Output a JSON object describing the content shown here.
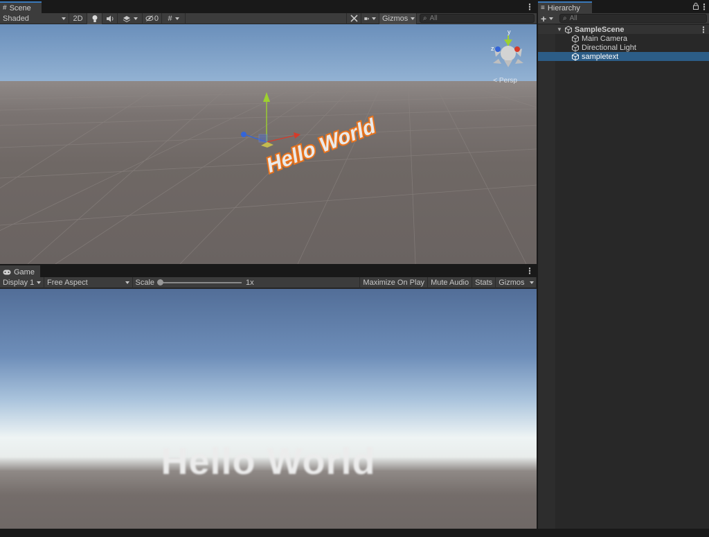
{
  "scene": {
    "tab_label": "Scene",
    "shading_mode": "Shaded",
    "mode_2d": "2D",
    "hidden_count": "0",
    "gizmos_label": "Gizmos",
    "search_placeholder": "All",
    "hello_text": "Hello World",
    "gizmo_axis_y": "y",
    "gizmo_axis_z": "z",
    "persp_label": "< Persp"
  },
  "game": {
    "tab_label": "Game",
    "display": "Display 1",
    "aspect": "Free Aspect",
    "scale_label": "Scale",
    "scale_value": "1x",
    "maximize_label": "Maximize On Play",
    "mute_label": "Mute Audio",
    "stats_label": "Stats",
    "gizmos_label": "Gizmos",
    "hello_text": "Hello World"
  },
  "hierarchy": {
    "tab_label": "Hierarchy",
    "add_label": "+",
    "search_placeholder": "All",
    "scene_name": "SampleScene",
    "items": [
      {
        "label": "Main Camera"
      },
      {
        "label": "Directional Light"
      },
      {
        "label": "sampletext"
      }
    ]
  },
  "colors": {
    "selection": "#2c5d87",
    "tab_accent": "#3a79bb",
    "text_outline": "#e8731d"
  }
}
